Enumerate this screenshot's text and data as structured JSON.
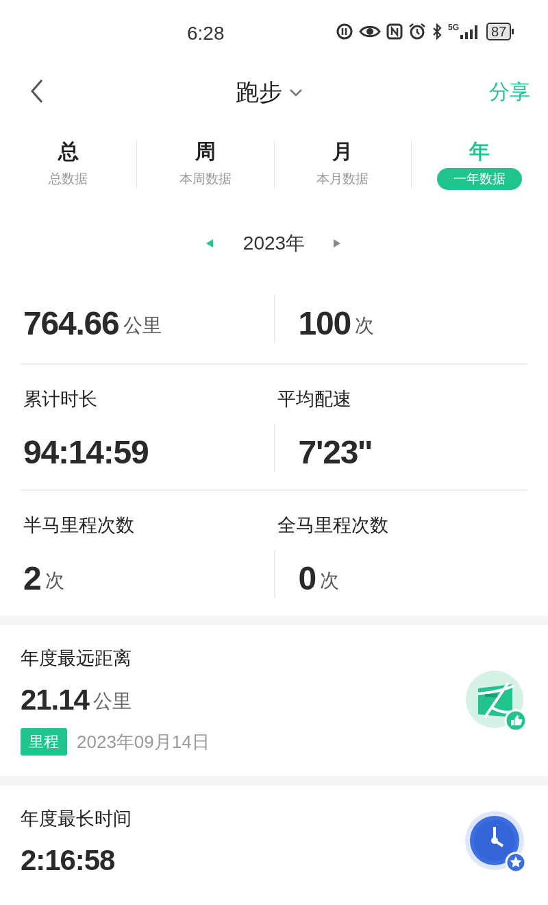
{
  "status_bar": {
    "time": "6:28",
    "network": "5G",
    "battery": "87"
  },
  "header": {
    "title": "跑步",
    "action": "分享"
  },
  "tabs": [
    {
      "title": "总",
      "subtitle": "总数据",
      "selected": false
    },
    {
      "title": "周",
      "subtitle": "本周数据",
      "selected": false
    },
    {
      "title": "月",
      "subtitle": "本月数据",
      "selected": false
    },
    {
      "title": "年",
      "subtitle": "一年数据",
      "selected": true
    }
  ],
  "period": {
    "label": "2023年"
  },
  "stats": [
    [
      {
        "value": "764.66",
        "unit": "公里"
      },
      {
        "value": "100",
        "unit": "次"
      }
    ],
    [
      {
        "label": "累计时长",
        "value": "94:14:59"
      },
      {
        "label": "平均配速",
        "value": "7'23''"
      }
    ],
    [
      {
        "label": "半马里程次数",
        "value": "2",
        "unit": "次"
      },
      {
        "label": "全马里程次数",
        "value": "0",
        "unit": "次"
      }
    ]
  ],
  "records": [
    {
      "kind": "distance",
      "title": "年度最远距离",
      "value": "21.14",
      "unit": "公里",
      "tag": "里程",
      "date": "2023年09月14日"
    },
    {
      "kind": "time",
      "title": "年度最长时间",
      "value": "2:16:58"
    }
  ]
}
